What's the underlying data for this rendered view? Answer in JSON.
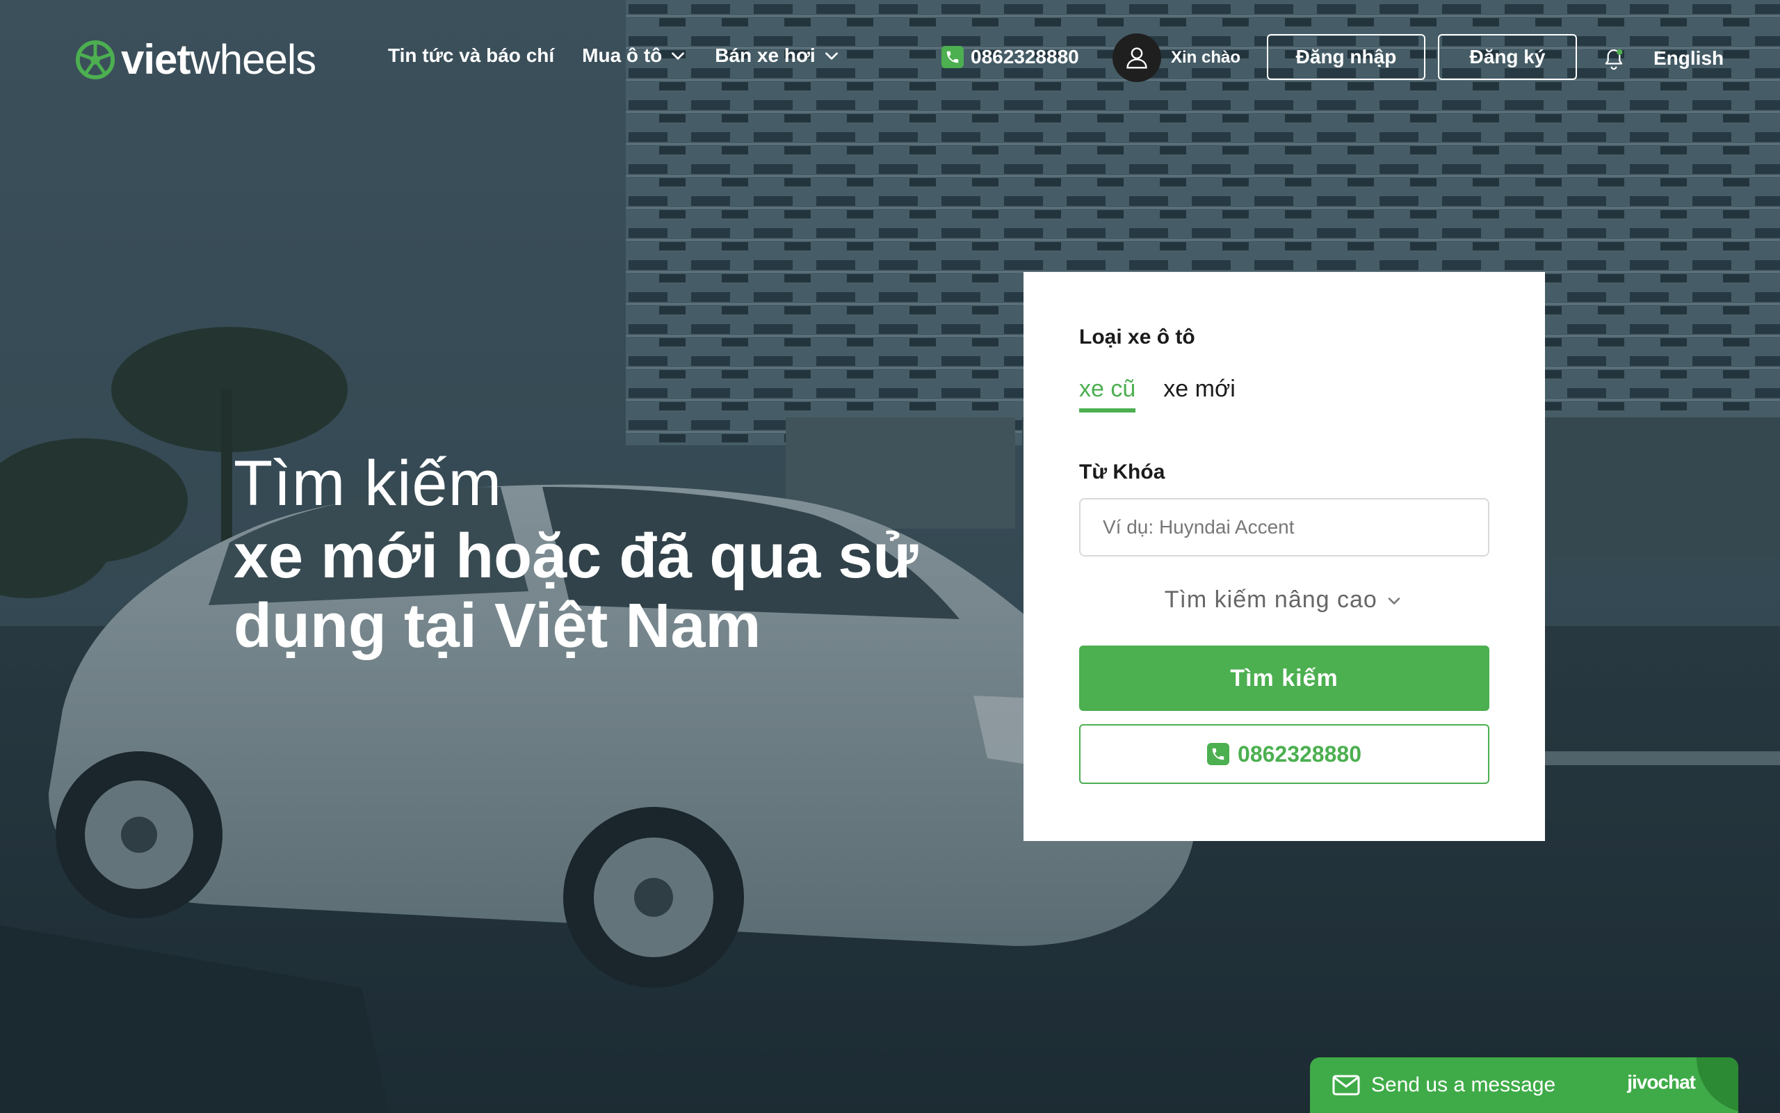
{
  "brand": {
    "name_part1": "viet",
    "name_part2": "wheels",
    "logo_icon": "wheel-icon",
    "accent_color": "#4caf50"
  },
  "nav": {
    "items": [
      {
        "label": "Tin tức và báo chí",
        "has_dropdown": false
      },
      {
        "label": "Mua ô tô",
        "has_dropdown": true
      },
      {
        "label": "Bán xe hơi",
        "has_dropdown": true
      }
    ],
    "phone": "0862328880",
    "greeting": "Xin chào",
    "login_label": "Đăng nhập",
    "register_label": "Đăng ký",
    "language": "English"
  },
  "hero": {
    "line1": "Tìm kiếm",
    "line2": "xe mới hoặc đã qua sử",
    "line3": "dụng tại Việt Nam"
  },
  "search_card": {
    "type_label": "Loại xe ô tô",
    "tabs": [
      {
        "label": "xe cũ",
        "active": true
      },
      {
        "label": "xe mới",
        "active": false
      }
    ],
    "keyword_label": "Từ Khóa",
    "keyword_placeholder": "Ví dụ: Huyndai Accent",
    "keyword_value": "",
    "advanced_label": "Tìm kiếm nâng cao",
    "search_button": "Tìm kiếm",
    "phone_button": "0862328880"
  },
  "chat": {
    "message_label": "Send us a message",
    "brand": "jivochat"
  }
}
